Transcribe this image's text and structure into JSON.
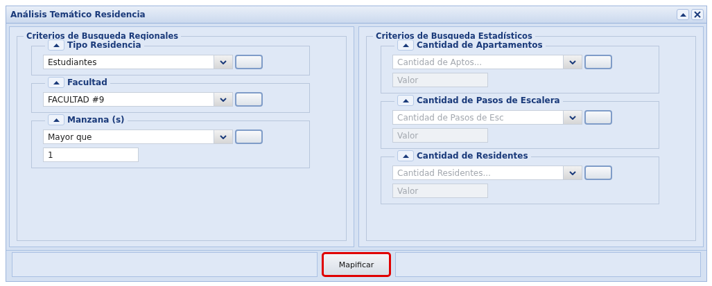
{
  "window": {
    "title": "Análisis Temático Residencia"
  },
  "panels": [
    {
      "title": "Criterios de Busqueda Regionales",
      "groups": [
        {
          "title": "Tipo Residencia",
          "expanded": true,
          "select": {
            "value": "Estudiantes",
            "disabled": false
          }
        },
        {
          "title": "Facultad",
          "expanded": true,
          "select": {
            "value": "FACULTAD #9",
            "disabled": false
          }
        },
        {
          "title": "Manzana (s)",
          "expanded": true,
          "select": {
            "value": "Mayor que",
            "disabled": false
          },
          "field": {
            "value": "1",
            "disabled": false
          }
        }
      ]
    },
    {
      "title": "Criterios de Busqueda Estadísticos",
      "groups": [
        {
          "title": "Cantidad de Apartamentos",
          "expanded": true,
          "select": {
            "placeholder": "Cantidad de Aptos...",
            "disabled": true
          },
          "field": {
            "placeholder": "Valor",
            "disabled": true
          }
        },
        {
          "title": "Cantidad de Pasos de Escalera",
          "expanded": true,
          "select": {
            "placeholder": "Cantidad de Pasos de Esc",
            "disabled": true
          },
          "field": {
            "placeholder": "Valor",
            "disabled": true
          }
        },
        {
          "title": "Cantidad de Residentes",
          "expanded": true,
          "select": {
            "placeholder": "Cantidad Residentes...",
            "disabled": true
          },
          "field": {
            "placeholder": "Valor",
            "disabled": true
          }
        }
      ]
    }
  ],
  "footer": {
    "button": {
      "label": "Mapificar",
      "highlighted": true
    }
  }
}
